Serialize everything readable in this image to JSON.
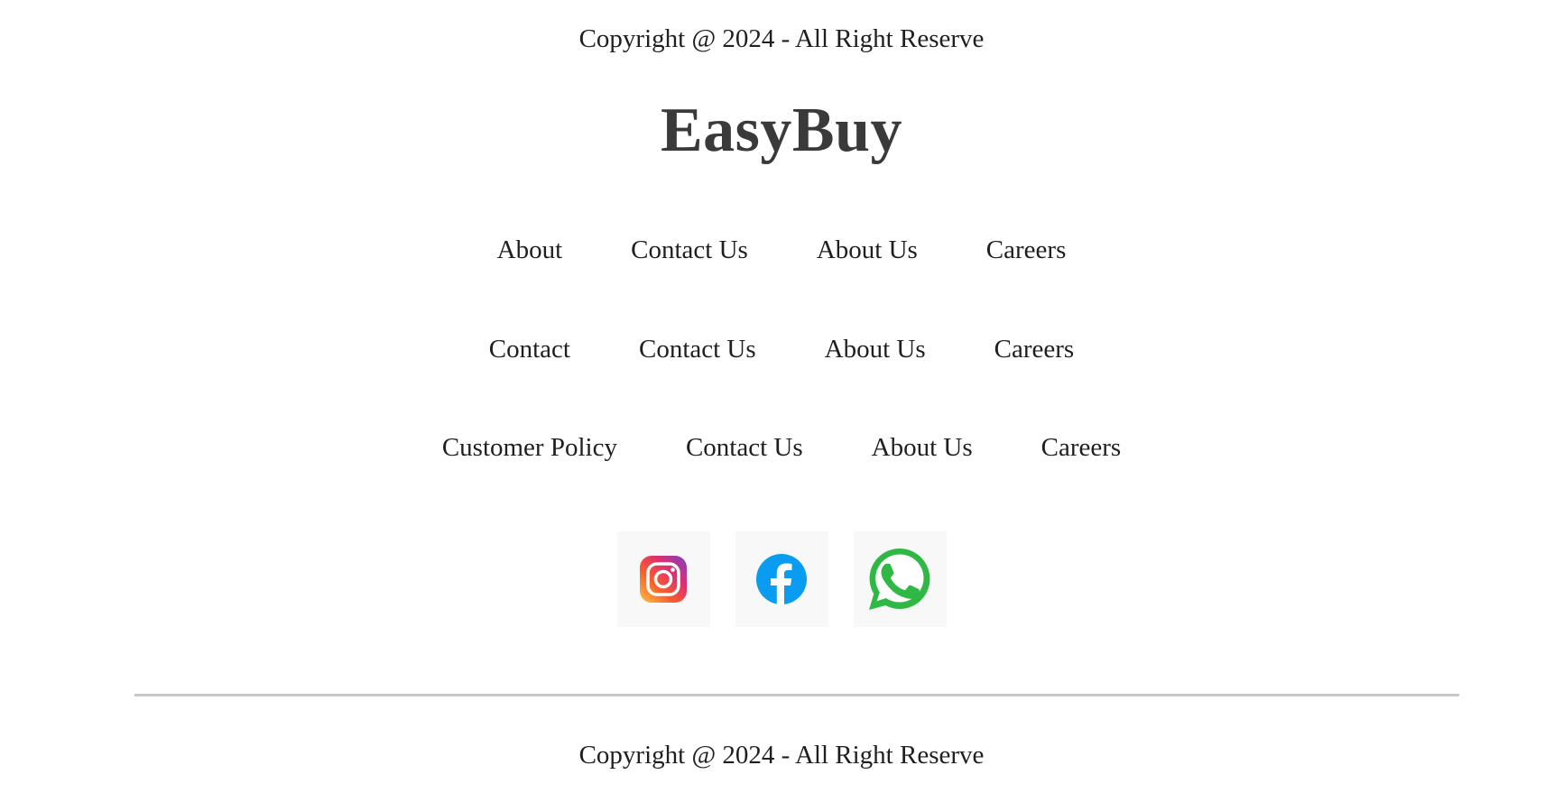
{
  "footer": {
    "copyright_top": "Copyright @ 2024 - All Right Reserve",
    "brand": "EasyBuy",
    "link_rows": [
      [
        "About",
        "Contact Us",
        "About Us",
        "Careers"
      ],
      [
        "Contact",
        "Contact Us",
        "About Us",
        "Careers"
      ],
      [
        "Customer Policy",
        "Contact Us",
        "About Us",
        "Careers"
      ]
    ],
    "socials": [
      {
        "name": "instagram-icon",
        "color": "#e1306c"
      },
      {
        "name": "facebook-icon",
        "color": "#0a9cf0"
      },
      {
        "name": "whatsapp-icon",
        "color": "#2fb844"
      }
    ],
    "copyright_bottom": "Copyright @ 2024 - All Right Reserve"
  }
}
